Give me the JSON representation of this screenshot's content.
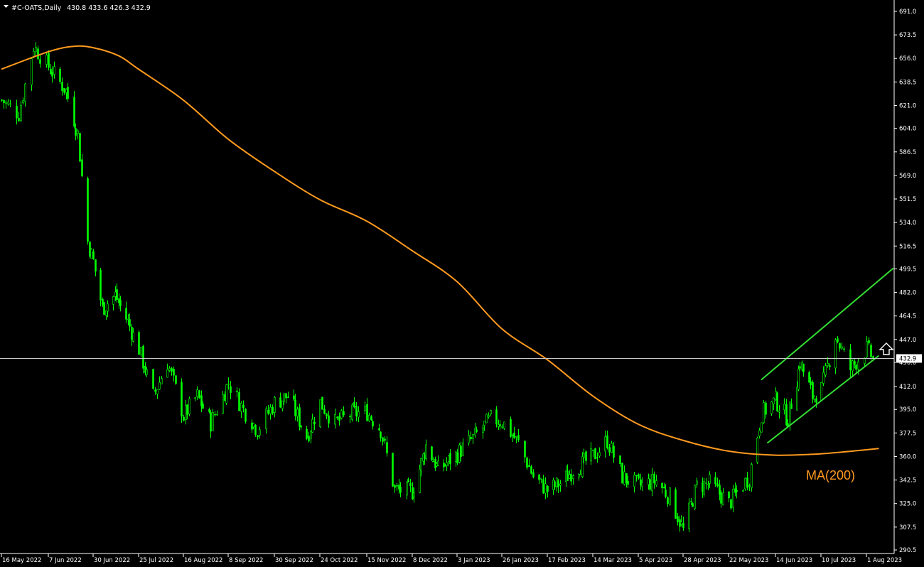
{
  "header": {
    "symbol": "#C-OATS,Daily",
    "ohlc": "430.8 433.6 426.3 432.9"
  },
  "colors": {
    "background": "#000000",
    "candle": "#00ff00",
    "ma": "#ff9a1f",
    "channel": "#33dd33",
    "price_line": "#c8c8c8",
    "axis_text": "#ffffff"
  },
  "current_price_label": "432.9",
  "ma_label": "MA(200)",
  "icons": {
    "arrow": "up-arrow-icon"
  },
  "chart_data": {
    "type": "candlestick",
    "title": "#C-OATS,Daily",
    "y_ticks": [
      "691.0",
      "673.5",
      "656.0",
      "638.5",
      "621.0",
      "604.0",
      "586.5",
      "569.0",
      "551.5",
      "534.0",
      "516.5",
      "499.5",
      "482.0",
      "464.5",
      "447.0",
      "430.0",
      "412.0",
      "395.0",
      "377.5",
      "360.0",
      "342.5",
      "325.0",
      "307.5",
      "290.5"
    ],
    "x_ticks": [
      "16 May 2022",
      "7 Jun 2022",
      "30 Jun 2022",
      "25 Jul 2022",
      "16 Aug 2022",
      "8 Sep 2022",
      "30 Sep 2022",
      "24 Oct 2022",
      "15 Nov 2022",
      "8 Dec 2022",
      "3 Jan 2023",
      "26 Jan 2023",
      "17 Feb 2023",
      "14 Mar 2023",
      "5 Apr 2023",
      "28 Apr 2023",
      "22 May 2023",
      "14 Jun 2023",
      "10 Jul 2023",
      "1 Aug 2023"
    ],
    "ylim": [
      290.5,
      691.0
    ],
    "price_path": [
      [
        "16 May 2022",
        625
      ],
      [
        "24 May 2022",
        615
      ],
      [
        "31 May 2022",
        665
      ],
      [
        "7 Jun 2022",
        650
      ],
      [
        "16 Jun 2022",
        632
      ],
      [
        "22 Jun 2022",
        600
      ],
      [
        "27 Jun 2022",
        520
      ],
      [
        "30 Jun 2022",
        505
      ],
      [
        "5 Jul 2022",
        470
      ],
      [
        "12 Jul 2022",
        480
      ],
      [
        "19 Jul 2022",
        460
      ],
      [
        "25 Jul 2022",
        440
      ],
      [
        "1 Aug 2022",
        405
      ],
      [
        "8 Aug 2022",
        430
      ],
      [
        "16 Aug 2022",
        390
      ],
      [
        "23 Aug 2022",
        405
      ],
      [
        "30 Aug 2022",
        385
      ],
      [
        "8 Sep 2022",
        415
      ],
      [
        "15 Sep 2022",
        395
      ],
      [
        "22 Sep 2022",
        380
      ],
      [
        "30 Sep 2022",
        400
      ],
      [
        "7 Oct 2022",
        405
      ],
      [
        "17 Oct 2022",
        375
      ],
      [
        "24 Oct 2022",
        400
      ],
      [
        "31 Oct 2022",
        385
      ],
      [
        "8 Nov 2022",
        392
      ],
      [
        "15 Nov 2022",
        393
      ],
      [
        "22 Nov 2022",
        380
      ],
      [
        "29 Nov 2022",
        335
      ],
      [
        "8 Dec 2022",
        334
      ],
      [
        "16 Dec 2022",
        368
      ],
      [
        "23 Dec 2022",
        350
      ],
      [
        "3 Jan 2023",
        362
      ],
      [
        "12 Jan 2023",
        375
      ],
      [
        "20 Jan 2023",
        388
      ],
      [
        "26 Jan 2023",
        386
      ],
      [
        "3 Feb 2023",
        370
      ],
      [
        "10 Feb 2023",
        345
      ],
      [
        "17 Feb 2023",
        335
      ],
      [
        "24 Feb 2023",
        340
      ],
      [
        "3 Mar 2023",
        350
      ],
      [
        "14 Mar 2023",
        360
      ],
      [
        "21 Mar 2023",
        372
      ],
      [
        "28 Mar 2023",
        345
      ],
      [
        "5 Apr 2023",
        338
      ],
      [
        "14 Apr 2023",
        342
      ],
      [
        "21 Apr 2023",
        330
      ],
      [
        "28 Apr 2023",
        305
      ],
      [
        "5 May 2023",
        338
      ],
      [
        "12 May 2023",
        340
      ],
      [
        "22 May 2023",
        325
      ],
      [
        "1 Jun 2023",
        345
      ],
      [
        "7 Jun 2023",
        392
      ],
      [
        "14 Jun 2023",
        402
      ],
      [
        "21 Jun 2023",
        388
      ],
      [
        "28 Jun 2023",
        430
      ],
      [
        "5 Jul 2023",
        405
      ],
      [
        "10 Jul 2023",
        410
      ],
      [
        "17 Jul 2023",
        450
      ],
      [
        "24 Jul 2023",
        425
      ],
      [
        "1 Aug 2023",
        440
      ],
      [
        "4 Aug 2023",
        432.9
      ]
    ],
    "moving_average": {
      "name": "MA(200)",
      "points": [
        [
          "16 May 2022",
          648
        ],
        [
          "7 Jun 2022",
          661
        ],
        [
          "20 Jun 2022",
          665
        ],
        [
          "30 Jun 2022",
          664
        ],
        [
          "14 Jul 2022",
          658
        ],
        [
          "25 Jul 2022",
          648
        ],
        [
          "16 Aug 2022",
          625
        ],
        [
          "8 Sep 2022",
          596
        ],
        [
          "30 Sep 2022",
          572
        ],
        [
          "24 Oct 2022",
          551
        ],
        [
          "15 Nov 2022",
          535
        ],
        [
          "8 Dec 2022",
          513
        ],
        [
          "3 Jan 2023",
          490
        ],
        [
          "26 Jan 2023",
          455
        ],
        [
          "17 Feb 2023",
          432
        ],
        [
          "14 Mar 2023",
          405
        ],
        [
          "5 Apr 2023",
          384
        ],
        [
          "28 Apr 2023",
          372
        ],
        [
          "22 May 2023",
          364
        ],
        [
          "14 Jun 2023",
          361
        ],
        [
          "10 Jul 2023",
          362
        ],
        [
          "1 Aug 2023",
          365
        ],
        [
          "7 Aug 2023",
          366
        ]
      ]
    },
    "channel": {
      "upper": [
        [
          "7 Jun 2023",
          417
        ],
        [
          "14 Aug 2023",
          500
        ]
      ],
      "lower": [
        [
          "10 Jun 2023",
          370
        ],
        [
          "7 Aug 2023",
          435
        ]
      ]
    },
    "current_price": 432.9,
    "grid": false
  }
}
